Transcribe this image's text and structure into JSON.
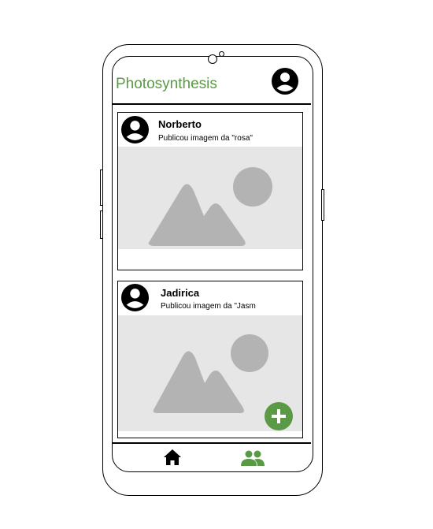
{
  "app": {
    "title": "Photosynthesis"
  },
  "colors": {
    "accent": "#5a9a46",
    "placeholder_bg": "#e6e6e6",
    "placeholder_shape": "#b3b3b3"
  },
  "feed": {
    "posts": [
      {
        "author": "Norberto",
        "caption": "Publicou imagem da \"rosa\""
      },
      {
        "author": "Jadirica",
        "caption": "Publicou imagem da \"Jasm"
      }
    ]
  },
  "icons": {
    "header_avatar": "user-avatar-icon",
    "fab": "plus-icon",
    "nav_home": "home-icon",
    "nav_friends": "people-icon"
  }
}
